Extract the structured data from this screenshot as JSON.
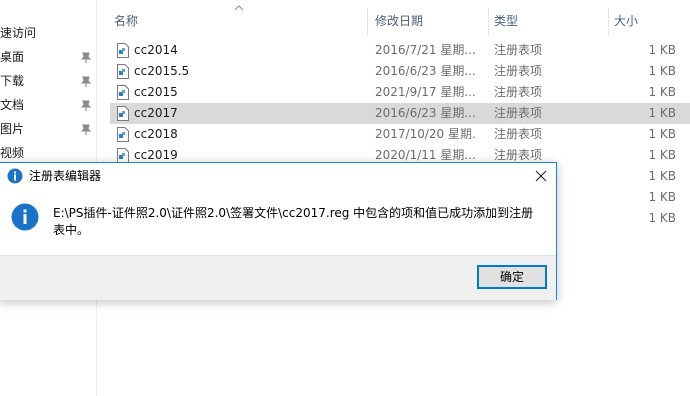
{
  "nav": {
    "items": [
      {
        "label": "速访问",
        "pinned": false
      },
      {
        "label": "桌面",
        "pinned": true
      },
      {
        "label": "下载",
        "pinned": true
      },
      {
        "label": "文档",
        "pinned": true
      },
      {
        "label": "图片",
        "pinned": true
      },
      {
        "label": "视频",
        "pinned": false
      }
    ]
  },
  "columns": {
    "name": "名称",
    "date": "修改日期",
    "type": "类型",
    "size": "大小"
  },
  "files": [
    {
      "name": "cc2014",
      "date": "2016/7/21 星期...",
      "type": "注册表项",
      "size": "1 KB"
    },
    {
      "name": "cc2015.5",
      "date": "2016/6/23 星期...",
      "type": "注册表项",
      "size": "1 KB"
    },
    {
      "name": "cc2015",
      "date": "2021/9/17 星期...",
      "type": "注册表项",
      "size": "1 KB"
    },
    {
      "name": "cc2017",
      "date": "2016/6/23 星期...",
      "type": "注册表项",
      "size": "1 KB",
      "selected": true
    },
    {
      "name": "cc2018",
      "date": "2017/10/20 星期...",
      "type": "注册表项",
      "size": "1 KB"
    },
    {
      "name": "cc2019",
      "date": "2020/1/11 星期...",
      "type": "注册表项",
      "size": "1 KB"
    },
    {
      "name": "",
      "date": "",
      "type": "",
      "size": "1 KB"
    },
    {
      "name": "",
      "date": "",
      "type": "",
      "size": "1 KB"
    },
    {
      "name": "",
      "date": "",
      "type": "",
      "size": "1 KB"
    }
  ],
  "dialog": {
    "title": "注册表编辑器",
    "message": "E:\\PS插件-证件照2.0\\证件照2.0\\签署文件\\cc2017.reg 中包含的项和值已成功添加到注册表中。",
    "ok_label": "确定"
  },
  "colors": {
    "accent": "#0078d7",
    "selected_row": "#d9d9d9",
    "info_icon": "#1a73c9"
  }
}
